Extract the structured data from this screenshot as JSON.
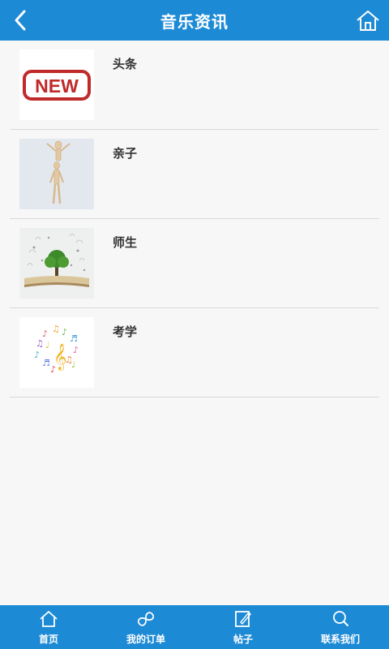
{
  "header": {
    "title": "音乐资讯",
    "back_icon": "chevron-left-icon",
    "home_icon": "home-icon",
    "color": "#1d8ad6"
  },
  "list": {
    "items": [
      {
        "label": "头条",
        "thumb": "new-badge-image"
      },
      {
        "label": "亲子",
        "thumb": "wooden-figures-image"
      },
      {
        "label": "师生",
        "thumb": "tree-book-image"
      },
      {
        "label": "考学",
        "thumb": "music-notes-image"
      }
    ]
  },
  "tabbar": {
    "tabs": [
      {
        "label": "首页",
        "icon": "home-icon"
      },
      {
        "label": "我的订单",
        "icon": "infinity-icon"
      },
      {
        "label": "帖子",
        "icon": "edit-icon"
      },
      {
        "label": "联系我们",
        "icon": "search-icon"
      }
    ]
  }
}
